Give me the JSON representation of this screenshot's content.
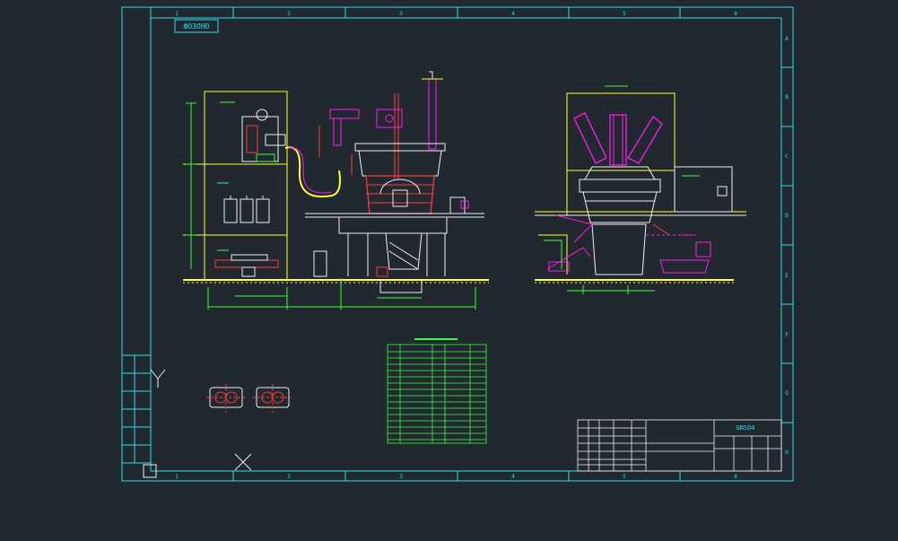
{
  "drawing": {
    "stamp": "ФОЗОНО",
    "title_code": "GNSO4",
    "top_numbers": [
      "1",
      "2",
      "3",
      "4",
      "5",
      "6"
    ],
    "bottom_numbers": [
      "1",
      "2",
      "3",
      "4",
      "5",
      "6"
    ],
    "right_letters": [
      "A",
      "B",
      "C",
      "D",
      "E",
      "F",
      "G",
      "H"
    ]
  },
  "colors": {
    "background": "#212830",
    "frame": "#27e0f0",
    "lines_white": "#f0f0f0",
    "lines_red": "#ff3a3a",
    "lines_magenta": "#ff1cf0",
    "lines_yellow": "#ffff33",
    "lines_green": "#39ff39",
    "lines_cyan": "#27e0f0"
  },
  "icons": [
    "ucs-axis-icon",
    "crosshair-icon"
  ]
}
